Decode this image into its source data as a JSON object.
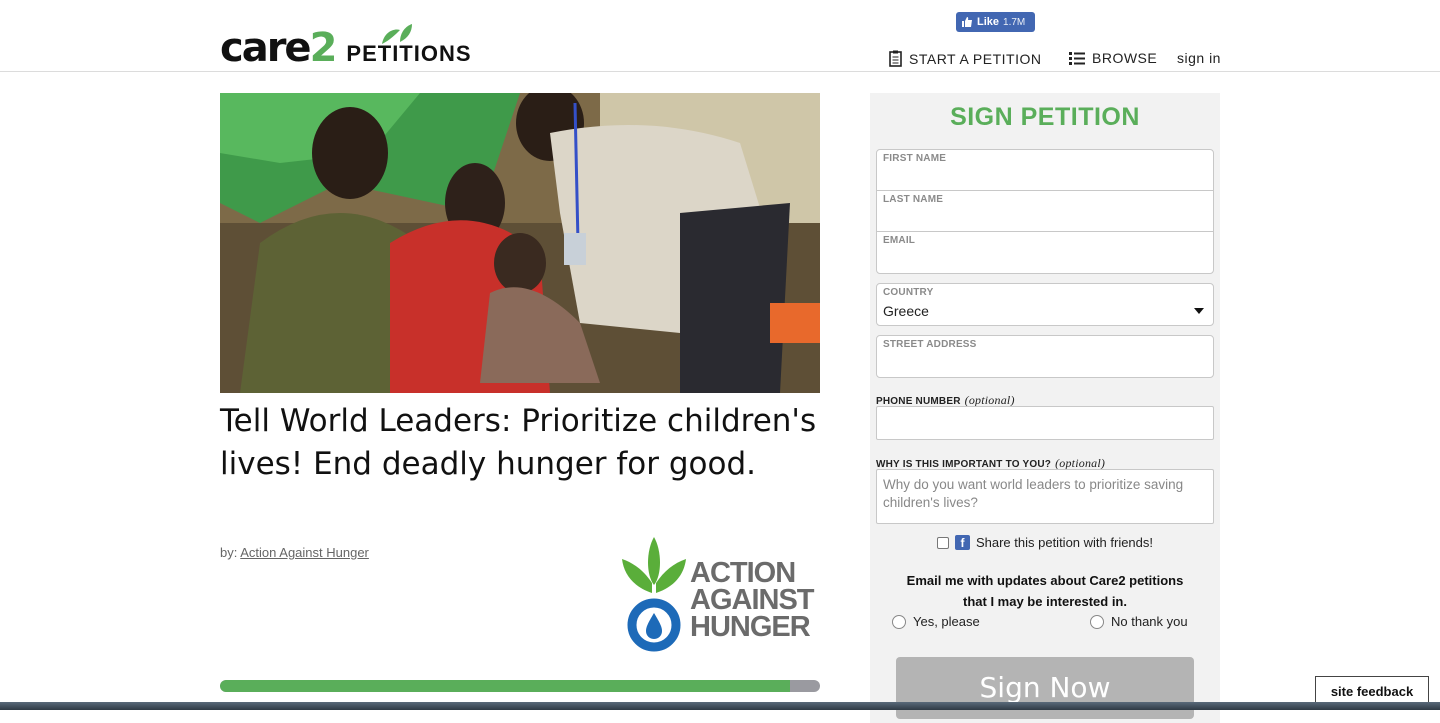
{
  "brand": {
    "care": "care",
    "two": "2",
    "petitions": "PETITIONS"
  },
  "facebook": {
    "like_label": "Like",
    "like_count": "1.7M"
  },
  "nav": {
    "start": "START A PETITION",
    "browse": "BROWSE",
    "signin": "sign in"
  },
  "petition": {
    "title": "Tell World Leaders: Prioritize children's lives! End deadly hunger for good.",
    "by_prefix": "by:",
    "author": "Action Against Hunger",
    "org_logo_text": [
      "ACTION",
      "AGAINST",
      "HUNGER"
    ],
    "progress_fraction": 0.95
  },
  "form": {
    "heading": "SIGN PETITION",
    "first_name_label": "FIRST NAME",
    "last_name_label": "LAST NAME",
    "email_label": "EMAIL",
    "country_label": "COUNTRY",
    "country_value": "Greece",
    "street_label": "STREET ADDRESS",
    "phone_label": "PHONE NUMBER",
    "phone_optional": "(optional)",
    "why_label": "WHY IS THIS IMPORTANT TO YOU?",
    "why_optional": "(optional)",
    "why_placeholder": "Why do you want world leaders to prioritize saving children's lives?",
    "share_label": "Share this petition with friends!",
    "email_question": "Email me with updates about Care2 petitions that I may be interested in.",
    "yes_label": "Yes, please",
    "no_label": "No thank you",
    "submit_label": "Sign Now"
  },
  "feedback_label": "site feedback",
  "colors": {
    "brand_green": "#5aae5a",
    "facebook_blue": "#4267b2",
    "aah_blue": "#1d6ab8"
  }
}
